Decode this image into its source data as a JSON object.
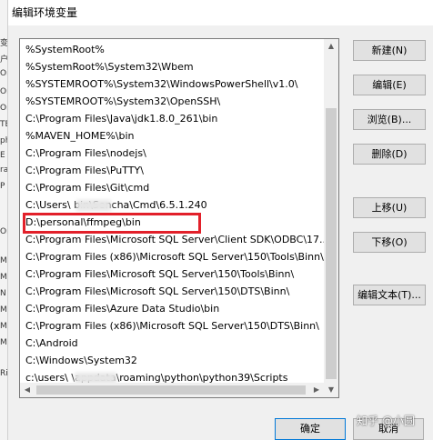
{
  "background_window": {
    "fragments": [
      "变",
      "户",
      "Or",
      "Or",
      "Or",
      "TE",
      "ph",
      "E",
      "ra",
      "P",
      "Or",
      "M",
      "M",
      "N",
      "M",
      "M",
      "M",
      "Ri"
    ]
  },
  "dialog": {
    "title": "编辑环境变量",
    "path_list": [
      "%SystemRoot%",
      "%SystemRoot%\\System32\\Wbem",
      "%SYSTEMROOT%\\System32\\WindowsPowerShell\\v1.0\\",
      "%SYSTEMROOT%\\System32\\OpenSSH\\",
      "C:\\Program Files\\Java\\jdk1.8.0_261\\bin",
      "%MAVEN_HOME%\\bin",
      "C:\\Program Files\\nodejs\\",
      "C:\\Program Files\\PuTTY\\",
      "C:\\Program Files\\Git\\cmd",
      "C:\\Users\\        bin\\Sencha\\Cmd\\6.5.1.240",
      "D:\\personal\\ffmpeg\\bin",
      "C:\\Program Files\\Microsoft SQL Server\\Client SDK\\ODBC\\17...",
      "C:\\Program Files (x86)\\Microsoft SQL Server\\150\\Tools\\Binn\\",
      "C:\\Program Files\\Microsoft SQL Server\\150\\Tools\\Binn\\",
      "C:\\Program Files\\Microsoft SQL Server\\150\\DTS\\Binn\\",
      "C:\\Program Files\\Azure Data Studio\\bin",
      "C:\\Program Files (x86)\\Microsoft SQL Server\\150\\DTS\\Binn\\",
      "C:\\Android",
      "C:\\Windows\\System32",
      "c:\\users\\        \\appdata\\roaming\\python\\python39\\Scripts"
    ],
    "buttons": {
      "new": "新建(N)",
      "edit": "编辑(E)",
      "browse": "浏览(B)...",
      "delete": "删除(D)",
      "move_up": "上移(U)",
      "move_down": "下移(O)",
      "edit_text": "编辑文本(T)..."
    },
    "ok": "确定",
    "cancel": "取消"
  },
  "watermark": "知乎 @小圆",
  "colors": {
    "highlight": "#e2202a",
    "accent": "#0078d7"
  }
}
